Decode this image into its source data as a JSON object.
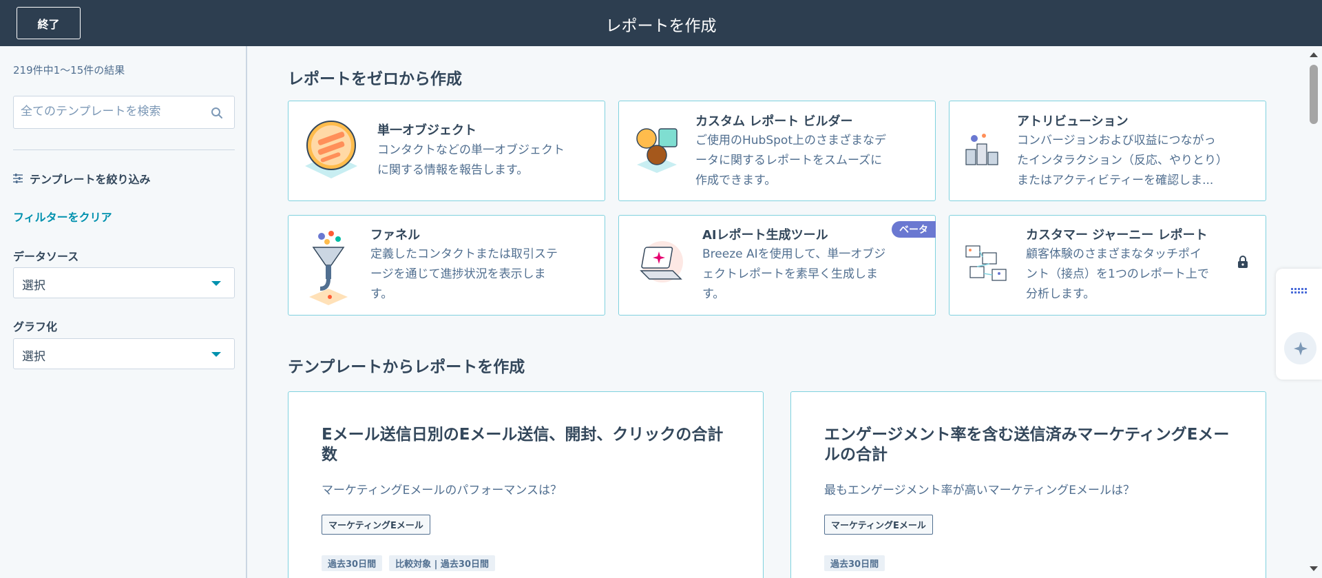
{
  "header": {
    "exit_label": "終了",
    "title": "レポートを作成"
  },
  "sidebar": {
    "result_count": "219件中1〜15件の結果",
    "search_placeholder": "全てのテンプレートを検索",
    "filter_toggle_label": "テンプレートを絞り込み",
    "clear_filters_label": "フィルターをクリア",
    "data_source_label": "データソース",
    "data_source_value": "選択",
    "visualization_label": "グラフ化",
    "visualization_value": "選択"
  },
  "main": {
    "scratch_section_title": "レポートをゼロから作成",
    "scratch_cards": [
      {
        "title": "単一オブジェクト",
        "desc1": "コンタクトなどの単一オブジェクト",
        "desc2": "に関する情報を報告します。",
        "desc3": ""
      },
      {
        "title": "カスタム レポート ビルダー",
        "desc1": "ご使用のHubSpot上のさまざまなデ",
        "desc2": "ータに関するレポートをスムーズに",
        "desc3": "作成できます。"
      },
      {
        "title": "アトリビューション",
        "desc1": "コンバージョンおよび収益につながっ",
        "desc2": "たインタラクション（反応、やりとり）",
        "desc3": "またはアクティビティーを確認しま..."
      },
      {
        "title": "ファネル",
        "desc1": "定義したコンタクトまたは取引ステ",
        "desc2": "ージを通じて進捗状況を表示しま",
        "desc3": "す。"
      },
      {
        "title": "AIレポート生成ツール",
        "desc1": "Breeze AIを使用して、単一オブジ",
        "desc2": "ェクトレポートを素早く生成しま",
        "desc3": "す。",
        "badge": "ベータ"
      },
      {
        "title": "カスタマー ジャーニー レポート",
        "desc1": "顧客体験のさまざまなタッチポイ",
        "desc2": "ント（接点）を1つのレポート上で",
        "desc3": "分析します。"
      }
    ],
    "template_section_title": "テンプレートからレポートを作成",
    "template_cards": [
      {
        "title": "Eメール送信日別のEメール送信、開封、クリックの合計数",
        "desc": "マーケティングEメールのパフォーマンスは？",
        "tag": "マーケティングEメール",
        "chip1": "過去30日間",
        "chip2": "比較対象 | 過去30日間"
      },
      {
        "title": "エンゲージメント率を含む送信済みマーケティングEメールの合計",
        "desc": "最もエンゲージメント率が高いマーケティングEメールは？",
        "tag": "マーケティングEメール",
        "chip1": "過去30日間"
      }
    ]
  },
  "colors": {
    "header_bg": "#2d3e50",
    "accent": "#0091ae",
    "card_border": "#7fd1de",
    "beta_badge": "#6a78d1"
  }
}
